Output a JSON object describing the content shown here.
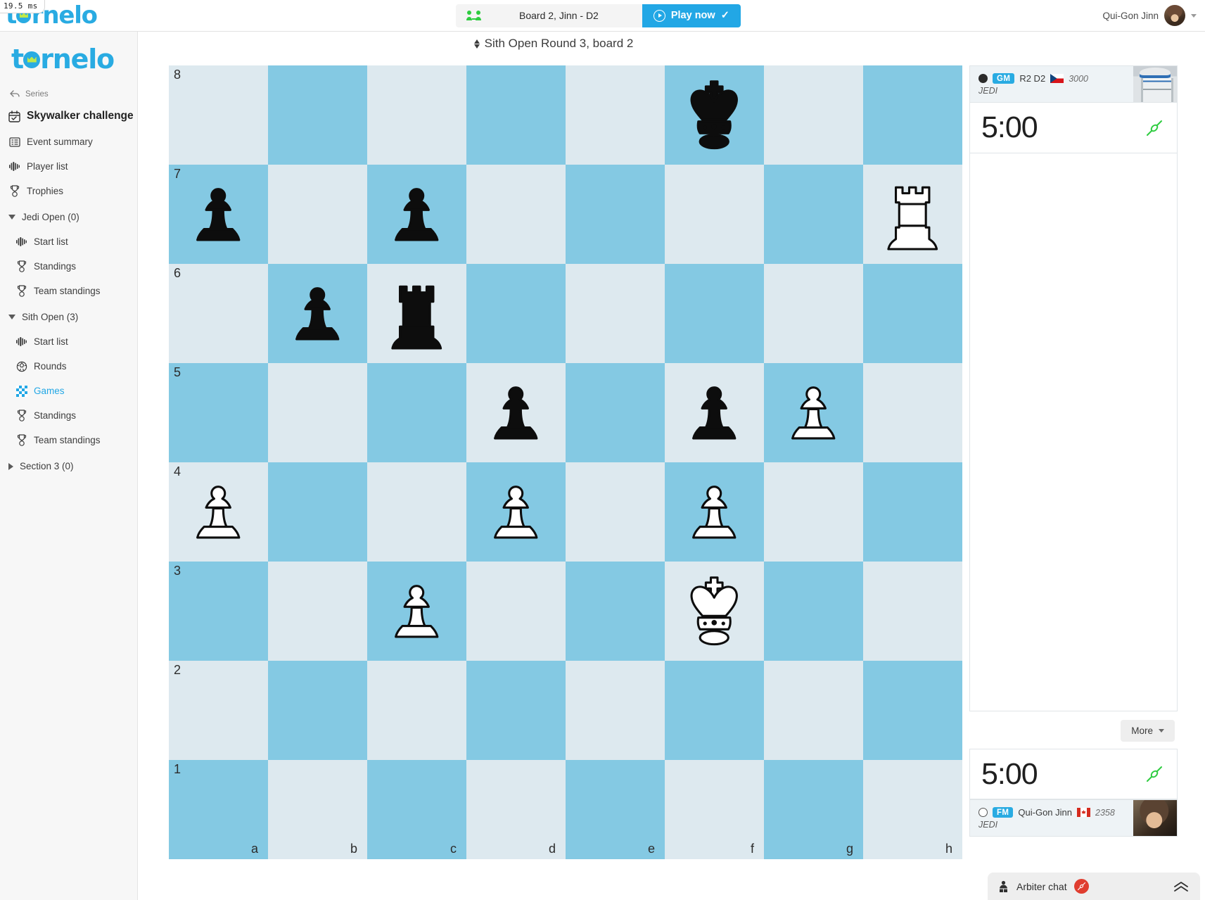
{
  "latency": {
    "value": "19.5",
    "unit": "ms"
  },
  "brand": {
    "name": "tornelo"
  },
  "topbar": {
    "board_label": "Board 2, Jinn - D2",
    "play_now_label": "Play now",
    "play_now_check": "✓",
    "users_icon": "two-players-icon",
    "user": {
      "name": "Qui-Gon Jinn"
    }
  },
  "sidebar": {
    "series_label": "Series",
    "event_title": "Skywalker challenge",
    "top_items": [
      {
        "label": "Event summary",
        "icon": "summary-icon"
      },
      {
        "label": "Player list",
        "icon": "player-list-icon"
      },
      {
        "label": "Trophies",
        "icon": "trophy-icon"
      }
    ],
    "groups": [
      {
        "label": "Jedi Open (0)",
        "expanded": true,
        "items": [
          {
            "label": "Start list",
            "icon": "player-list-icon",
            "active": false
          },
          {
            "label": "Standings",
            "icon": "trophy-icon",
            "active": false
          },
          {
            "label": "Team standings",
            "icon": "trophy-icon",
            "active": false
          }
        ]
      },
      {
        "label": "Sith Open (3)",
        "expanded": true,
        "items": [
          {
            "label": "Start list",
            "icon": "player-list-icon",
            "active": false
          },
          {
            "label": "Rounds",
            "icon": "rounds-icon",
            "active": false
          },
          {
            "label": "Games",
            "icon": "chessboard-icon",
            "active": true
          },
          {
            "label": "Standings",
            "icon": "trophy-icon",
            "active": false
          },
          {
            "label": "Team standings",
            "icon": "trophy-icon",
            "active": false
          }
        ]
      },
      {
        "label": "Section 3 (0)",
        "expanded": false,
        "items": []
      }
    ]
  },
  "board_header": {
    "title": "Sith Open Round 3, board 2"
  },
  "board": {
    "files": [
      "a",
      "b",
      "c",
      "d",
      "e",
      "f",
      "g",
      "h"
    ],
    "ranks": [
      "8",
      "7",
      "6",
      "5",
      "4",
      "3",
      "2",
      "1"
    ],
    "orientation": "white",
    "colors": {
      "light": "#dde9ef",
      "dark": "#84c9e3"
    },
    "fen": "5k2/p1p4R/1pr5/3p1pP1/P2P1P2/2P2K2/8/8",
    "position": [
      [
        "",
        "",
        "",
        "",
        "",
        "bk",
        "",
        ""
      ],
      [
        "bp",
        "",
        "bp",
        "",
        "",
        "",
        "",
        "wr"
      ],
      [
        "",
        "bp",
        "br",
        "",
        "",
        "",
        "",
        ""
      ],
      [
        "",
        "",
        "",
        "bp",
        "",
        "bp",
        "wp",
        ""
      ],
      [
        "wp",
        "",
        "",
        "wp",
        "",
        "wp",
        "",
        ""
      ],
      [
        "",
        "",
        "wp",
        "",
        "",
        "wk",
        "",
        ""
      ],
      [
        "",
        "",
        "",
        "",
        "",
        "",
        "",
        ""
      ],
      [
        "",
        "",
        "",
        "",
        "",
        "",
        "",
        ""
      ]
    ]
  },
  "players": {
    "black": {
      "color_name": "black",
      "title": "GM",
      "name": "R2 D2",
      "flag": "cz",
      "rating": "3000",
      "team": "JEDI",
      "clock": "5:00",
      "connection": "connected"
    },
    "white": {
      "color_name": "white",
      "title": "FM",
      "name": "Qui-Gon Jinn",
      "flag": "ca",
      "rating": "2358",
      "team": "JEDI",
      "clock": "5:00",
      "connection": "connected"
    }
  },
  "moves": [],
  "more_button": {
    "label": "More"
  },
  "arbiter_chat": {
    "label": "Arbiter chat",
    "badge_icon": "disconnected-icon",
    "expand_icon": "double-chevron-up-icon"
  },
  "theme": {
    "accent": "#22a7e5",
    "badge": "#29abe2",
    "connected": "#2ecc40",
    "alert": "#e03d2f",
    "sidebar_bg": "#f7f7f7"
  }
}
